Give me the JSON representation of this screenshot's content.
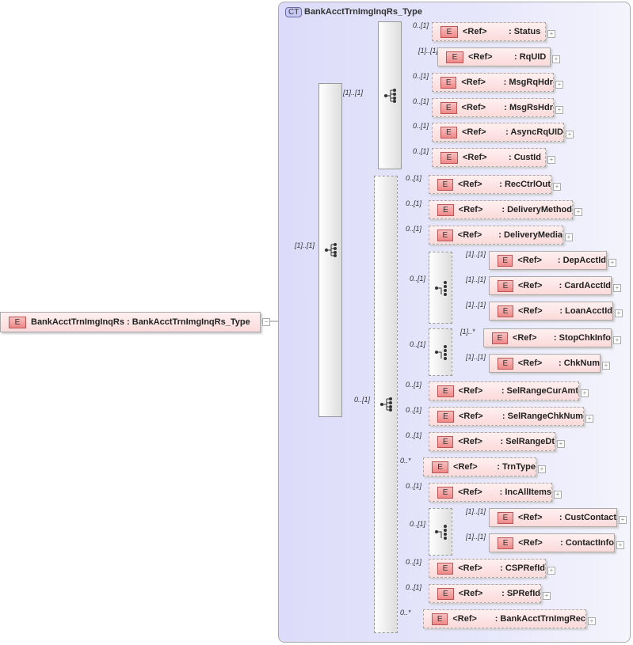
{
  "root": {
    "badge": "E",
    "name": "BankAcctTrnImgInqRs",
    "type": ": BankAcctTrnImgInqRs_Type"
  },
  "complex_type": {
    "badge": "CT",
    "name": "BankAcctTrnImgInqRs_Type"
  },
  "ref_label": "<Ref>",
  "root_multiplicity": "[1]..[1]",
  "group1": {
    "multiplicity": "[1]..[1]",
    "elements": [
      {
        "name": ": Status",
        "mult": "0..[1]",
        "optional": true
      },
      {
        "name": ": RqUID",
        "mult": "[1]..[1]",
        "optional": false
      },
      {
        "name": ": MsgRqHdr",
        "mult": "0..[1]",
        "optional": true
      },
      {
        "name": ": MsgRsHdr",
        "mult": "0..[1]",
        "optional": true
      },
      {
        "name": ": AsyncRqUID",
        "mult": "0..[1]",
        "optional": true
      },
      {
        "name": ": CustId",
        "mult": "0..[1]",
        "optional": true
      }
    ]
  },
  "group2": {
    "multiplicity": "0..[1]",
    "elements": [
      {
        "name": ": RecCtrlOut",
        "mult": "0..[1]",
        "optional": true
      },
      {
        "name": ": DeliveryMethod",
        "mult": "0..[1]",
        "optional": true
      },
      {
        "name": ": DeliveryMedia",
        "mult": "0..[1]",
        "optional": true
      },
      {
        "name": ": DepAcctId",
        "mult": "[1]..[1]",
        "optional": false,
        "choice": 1
      },
      {
        "name": ": CardAcctId",
        "mult": "[1]..[1]",
        "optional": false,
        "choice": 1
      },
      {
        "name": ": LoanAcctId",
        "mult": "[1]..[1]",
        "optional": false,
        "choice": 1
      },
      {
        "name": ": StopChkInfo",
        "mult": "[1]..*",
        "optional": false,
        "choice": 2
      },
      {
        "name": ": ChkNum",
        "mult": "[1]..[1]",
        "optional": false,
        "choice": 2
      },
      {
        "name": ": SelRangeCurAmt",
        "mult": "0..[1]",
        "optional": true
      },
      {
        "name": ": SelRangeChkNum",
        "mult": "0..[1]",
        "optional": true
      },
      {
        "name": ": SelRangeDt",
        "mult": "0..[1]",
        "optional": true
      },
      {
        "name": ": TrnType",
        "mult": "0..*",
        "optional": true
      },
      {
        "name": ": IncAllItems",
        "mult": "0..[1]",
        "optional": true
      },
      {
        "name": ": CustContact",
        "mult": "[1]..[1]",
        "optional": false,
        "choice": 3
      },
      {
        "name": ": ContactInfo",
        "mult": "[1]..[1]",
        "optional": false,
        "choice": 3
      },
      {
        "name": ": CSPRefId",
        "mult": "0..[1]",
        "optional": true
      },
      {
        "name": ": SPRefId",
        "mult": "0..[1]",
        "optional": true
      },
      {
        "name": ": BankAcctTrnImgRec",
        "mult": "0..*",
        "optional": true
      }
    ]
  },
  "choices": [
    {
      "mult": "0..[1]"
    },
    {
      "mult": "0..[1]"
    },
    {
      "mult": "0..[1]"
    }
  ]
}
